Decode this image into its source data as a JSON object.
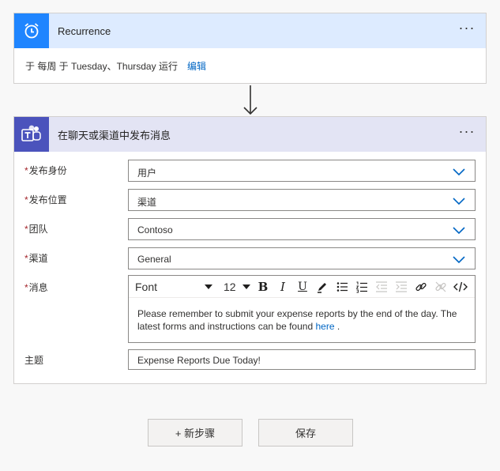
{
  "recurrence": {
    "title": "Recurrence",
    "summary": "于 每周 于 Tuesday、Thursday 运行",
    "edit_link": "编辑",
    "icon": "alarm-clock-icon",
    "accent": "#1f85ff"
  },
  "teams_action": {
    "title": "在聊天或渠道中发布消息",
    "icon": "teams-icon",
    "accent": "#4b53bc",
    "fields": {
      "post_as": {
        "label": "发布身份",
        "value": "用户"
      },
      "post_in": {
        "label": "发布位置",
        "value": "渠道"
      },
      "team": {
        "label": "团队",
        "value": "Contoso"
      },
      "channel": {
        "label": "渠道",
        "value": "General"
      },
      "message": {
        "label": "消息",
        "text_before_link": "Please remember to submit your expense reports by the end of the day. The latest forms and instructions can be found ",
        "link_text": "here",
        "text_after_link": " ."
      },
      "subject": {
        "label": "主题",
        "value": "Expense Reports Due Today!"
      }
    },
    "required_mark": "*",
    "editor_toolbar": {
      "font": "Font",
      "size": "12",
      "bold": "B",
      "italic": "I",
      "underline": "U"
    }
  },
  "footer": {
    "new_step": "+ 新步骤",
    "save": "保存"
  }
}
